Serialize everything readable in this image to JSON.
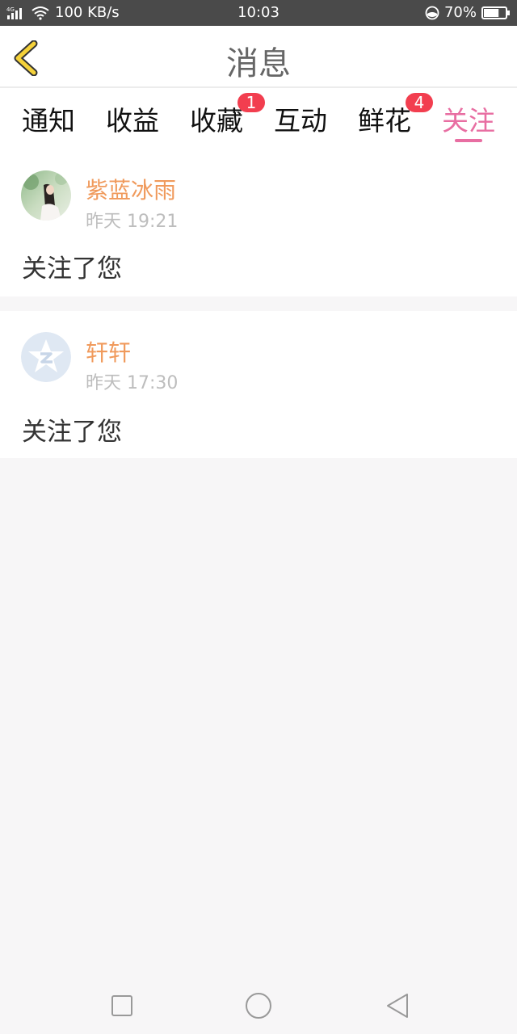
{
  "status_bar": {
    "network_type": "4G",
    "speed": "100 KB/s",
    "time": "10:03",
    "battery_percent": "70%",
    "battery_level": 0.7
  },
  "header": {
    "title": "消息"
  },
  "tabs": [
    {
      "label": "通知",
      "badge": ""
    },
    {
      "label": "收益",
      "badge": ""
    },
    {
      "label": "收藏",
      "badge": "1"
    },
    {
      "label": "互动",
      "badge": ""
    },
    {
      "label": "鲜花",
      "badge": "4"
    },
    {
      "label": "关注",
      "badge": "",
      "active": true
    }
  ],
  "messages": [
    {
      "user": "紫蓝冰雨",
      "time": "昨天 19:21",
      "text": "关注了您",
      "avatar": "photo-avatar"
    },
    {
      "user": "轩轩",
      "time": "昨天 17:30",
      "text": "关注了您",
      "avatar": "default-avatar-icon"
    }
  ],
  "colors": {
    "accent": "#e86ea2",
    "username": "#f09a5c",
    "badge": "#f23e4f",
    "back_arrow": "#f5d23a"
  },
  "icons": {
    "back": "chevron-left-icon",
    "nav_square": "recent-apps-icon",
    "nav_circle": "home-icon",
    "nav_triangle": "back-triangle-icon"
  }
}
